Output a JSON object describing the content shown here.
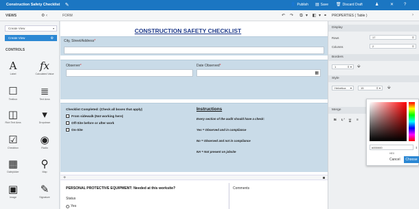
{
  "topbar": {
    "title": "Construction Safety Checklist",
    "publish": "Publish",
    "save": "Save",
    "discard": "Discard Draft",
    "accent": "#1b76c2"
  },
  "views": {
    "label": "VIEWS",
    "create_view_select": "Create View",
    "create_view_active": "Create View"
  },
  "controls": {
    "label": "CONTROLS",
    "items": [
      {
        "label": "Label",
        "icon": "A"
      },
      {
        "label": "Calculated Value",
        "icon": "fx"
      },
      {
        "label": "Textbox",
        "icon": "☐"
      },
      {
        "label": "Text Area",
        "icon": "≣"
      },
      {
        "label": "Rich Text Area",
        "icon": "◫"
      },
      {
        "label": "Dropdown",
        "icon": "▾"
      },
      {
        "label": "Checkbox",
        "icon": "☑"
      },
      {
        "label": "Radio",
        "icon": "◉"
      },
      {
        "label": "Datepicker",
        "icon": "▦"
      },
      {
        "label": "Map",
        "icon": "⚲"
      },
      {
        "label": "Image",
        "icon": "▣"
      },
      {
        "label": "Signature",
        "icon": "✎"
      }
    ]
  },
  "form": {
    "label": "FORM",
    "title": "CONSTRUCTION SAFETY CHECKLIST",
    "city_label": "City, Street/Address",
    "observer_label": "Observer",
    "date_label": "Date Observed",
    "required_mark": "*",
    "checklist_header": "Checklist Completed: (Check all boxes that apply)",
    "checklist_items": [
      "From sidewalk (Not working here)",
      "Off-Site before or after work",
      "On-Site"
    ],
    "instructions_title": "Instructions",
    "instructions": [
      "Every section of the audit should have a check:",
      "Yes = Observed and in compliance",
      "No = Observed and not in compliance",
      "NA = Not present on jobsite"
    ],
    "ppe_title": "PERSONAL PROTECTIVE EQUIPMENT: Needed at this worksite?",
    "comments_label": "Comments",
    "status_label": "Status",
    "yes_option": "Yes"
  },
  "properties": {
    "header": "PROPERTIES ( Table )",
    "display": "Display",
    "rows_label": "Rows",
    "rows_value": "17",
    "columns_label": "Columns",
    "columns_value": "2",
    "borders": "Borders",
    "border_width": "1",
    "style": "Style",
    "font_value": "Helvetica",
    "font_size": "15",
    "bold": "B",
    "italic": "I",
    "underline": "U",
    "merge": "Merge"
  },
  "color_picker": {
    "hex": "#000000",
    "hsb_label": "HEX",
    "cancel": "Cancel",
    "choose": "Choose",
    "hue_color": "#ff0000"
  }
}
